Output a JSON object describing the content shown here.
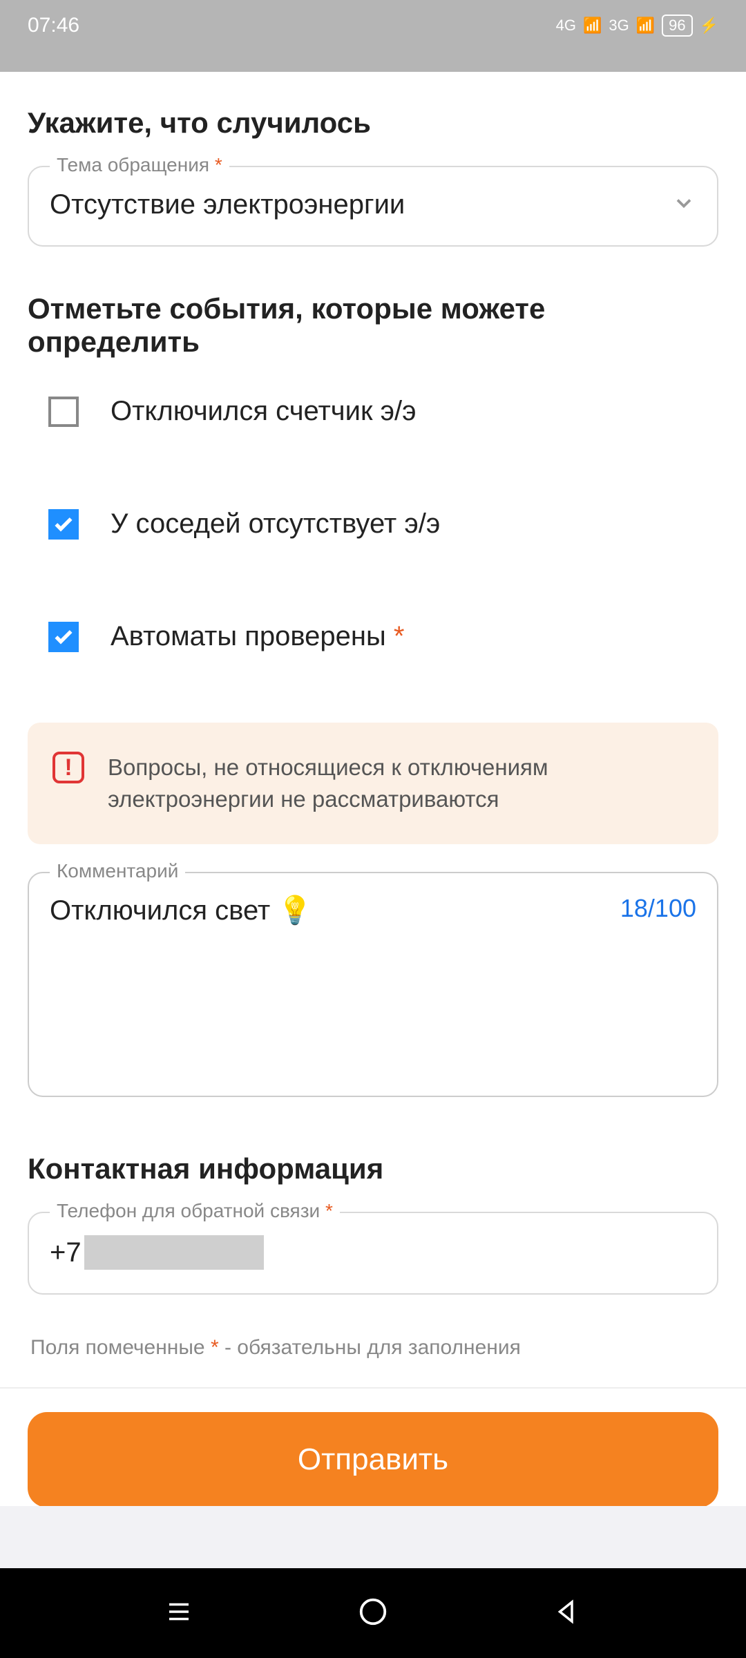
{
  "status": {
    "time": "07:46",
    "net1": "4G",
    "net2": "3G",
    "battery": "96"
  },
  "section1_title": "Укажите, что случилось",
  "topic": {
    "label": "Тема обращения",
    "value": "Отсутствие электроэнергии"
  },
  "section2_title": "Отметьте события, которые можете определить",
  "checks": [
    {
      "label": "Отключился счетчик э/э",
      "checked": false,
      "required": false
    },
    {
      "label": "У соседей отсутствует э/э",
      "checked": true,
      "required": false
    },
    {
      "label": "Автоматы проверены",
      "checked": true,
      "required": true
    }
  ],
  "warning": "Вопросы, не относящиеся к отключениям электроэнергии не рассматриваются",
  "comment": {
    "label": "Комментарий",
    "value": "Отключился свет 💡",
    "counter": "18/100"
  },
  "section3_title": "Контактная информация",
  "phone": {
    "label": "Телефон для обратной связи",
    "prefix": "+7"
  },
  "footnote_a": "Поля помеченные ",
  "footnote_b": " - обязательны для заполнения",
  "submit": "Отправить"
}
